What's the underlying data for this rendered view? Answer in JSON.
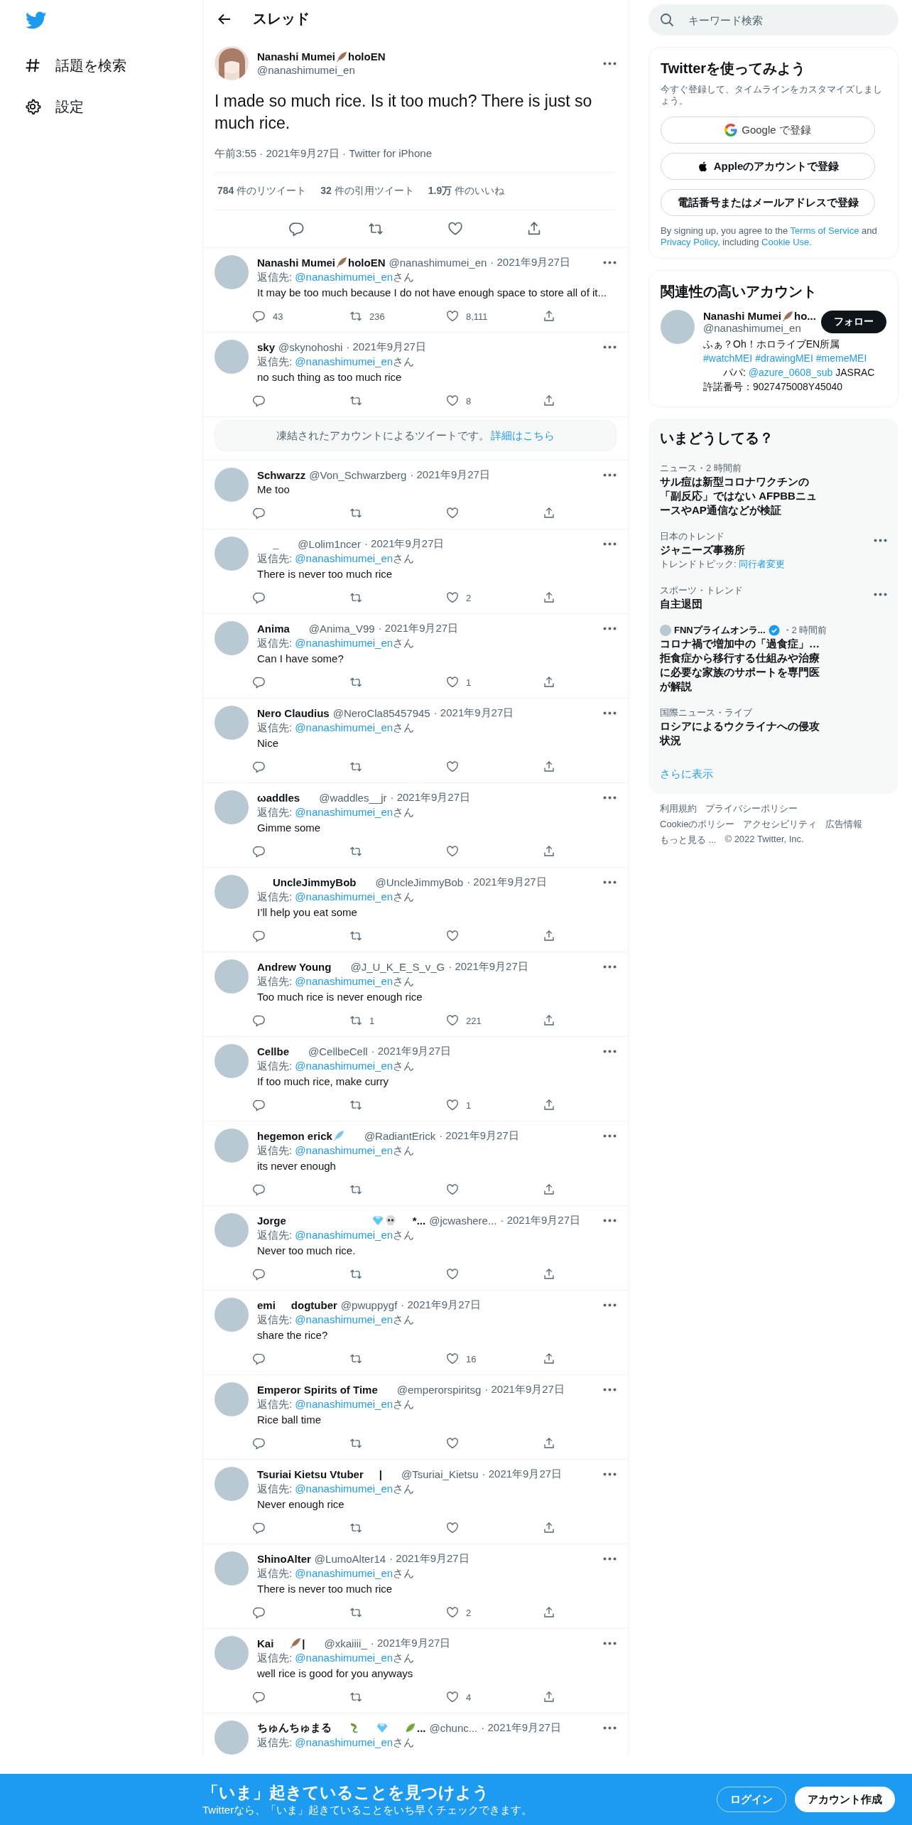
{
  "sidebar": {
    "items": [
      {
        "kind": "explore",
        "label": "話題を検索"
      },
      {
        "kind": "settings",
        "label": "設定"
      }
    ]
  },
  "header": {
    "title": "スレッド"
  },
  "tweet": {
    "name": [
      {
        "kind": "text",
        "text": "Nanashi Mumei"
      },
      {
        "kind": "feather"
      },
      {
        "kind": "text",
        "text": "holoEN"
      }
    ],
    "handle": "@nanashimumei_en",
    "text": "I made so much rice. Is it too much? There is just so much rice.",
    "meta": "午前3:55 · 2021年9月27日 · Twitter for iPhone",
    "stats": [
      "**784** 件のリツイート",
      "**32** 件の引用ツイート",
      "**1.9万** 件のいいね"
    ]
  },
  "replies": [
    {
      "kind": "tweet",
      "name": [
        {
          "kind": "text",
          "text": "Nanashi Mumei"
        },
        {
          "kind": "feather"
        },
        {
          "kind": "text",
          "text": "holoEN"
        }
      ],
      "handle": "@nanashimumei_en",
      "date": "· 2021年9月27日",
      "reply_to": {
        "prefix": "返信先: ",
        "handle": "@nanashimumei_en",
        "suffix": "さん"
      },
      "text": "It may be too much because I do not have enough space to store all of it...",
      "counts": {
        "reply": "43",
        "retweet": "236",
        "like": "8,111"
      }
    },
    {
      "kind": "tweet",
      "name": [
        {
          "kind": "text",
          "text": "sky"
        }
      ],
      "handle": "@skynohoshi",
      "date": "· 2021年9月27日",
      "reply_to": {
        "prefix": "返信先: ",
        "handle": "@nanashimumei_en",
        "suffix": "さん"
      },
      "text": "no such thing as too much rice",
      "counts": {
        "like": "8"
      }
    },
    {
      "kind": "notice",
      "text": "凍結されたアカウントによるツイートです。",
      "link": "詳細はこちら"
    },
    {
      "kind": "tweet",
      "name": [
        {
          "kind": "text",
          "text": "Schwarzz"
        }
      ],
      "handle": "@Von_Schwarzberg",
      "date": "· 2021年9月27日",
      "text": "Me too"
    },
    {
      "kind": "tweet",
      "name": [
        {
          "kind": "gap"
        },
        {
          "kind": "text",
          "text": "_"
        },
        {
          "kind": "gap"
        }
      ],
      "handle": "@Lolim1ncer",
      "date": "· 2021年9月27日",
      "reply_to": {
        "prefix": "返信先: ",
        "handle": "@nanashimumei_en",
        "suffix": "さん"
      },
      "text": "There is never too much rice",
      "counts": {
        "like": "2"
      }
    },
    {
      "kind": "tweet",
      "name": [
        {
          "kind": "text",
          "text": "Anima"
        },
        {
          "kind": "gap"
        }
      ],
      "handle": "@Anima_V99",
      "date": "· 2021年9月27日",
      "reply_to": {
        "prefix": "返信先: ",
        "handle": "@nanashimumei_en",
        "suffix": "さん"
      },
      "text": "Can I have some?",
      "counts": {
        "like": "1"
      }
    },
    {
      "kind": "tweet",
      "name": [
        {
          "kind": "text",
          "text": "Nero Claudius"
        }
      ],
      "handle": "@NeroCla85457945",
      "date": "· 2021年9月27日",
      "reply_to": {
        "prefix": "返信先: ",
        "handle": "@nanashimumei_en",
        "suffix": "さん"
      },
      "text": "Nice"
    },
    {
      "kind": "tweet",
      "name": [
        {
          "kind": "text",
          "text": "ωaddles"
        },
        {
          "kind": "gap"
        }
      ],
      "handle": "@waddles__jr",
      "date": "· 2021年9月27日",
      "reply_to": {
        "prefix": "返信先: ",
        "handle": "@nanashimumei_en",
        "suffix": "さん"
      },
      "text": "Gimme some"
    },
    {
      "kind": "tweet",
      "name": [
        {
          "kind": "gap"
        },
        {
          "kind": "text",
          "text": "UncleJimmyBob"
        },
        {
          "kind": "gap"
        }
      ],
      "handle": "@UncleJimmyBob",
      "date": "· 2021年9月27日",
      "reply_to": {
        "prefix": "返信先: ",
        "handle": "@nanashimumei_en",
        "suffix": "さん"
      },
      "text": "I’ll help you eat some"
    },
    {
      "kind": "tweet",
      "name": [
        {
          "kind": "text",
          "text": "Andrew Young"
        },
        {
          "kind": "gap"
        }
      ],
      "handle": "@J_U_K_E_S_v_G",
      "date": "· 2021年9月27日",
      "reply_to": {
        "prefix": "返信先: ",
        "handle": "@nanashimumei_en",
        "suffix": "さん"
      },
      "text": "Too much rice is never enough rice",
      "counts": {
        "retweet": "1",
        "like": "221"
      }
    },
    {
      "kind": "tweet",
      "name": [
        {
          "kind": "text",
          "text": "Cellbe"
        },
        {
          "kind": "gap"
        }
      ],
      "handle": "@CellbeCell",
      "date": "· 2021年9月27日",
      "reply_to": {
        "prefix": "返信先: ",
        "handle": "@nanashimumei_en",
        "suffix": "さん"
      },
      "text": "If too much rice, make curry",
      "counts": {
        "like": "1"
      }
    },
    {
      "kind": "tweet",
      "name": [
        {
          "kind": "text",
          "text": "hegemon erick"
        },
        {
          "kind": "blue-feather"
        },
        {
          "kind": "gap"
        }
      ],
      "handle": "@RadiantErick",
      "date": "· 2021年9月27日",
      "reply_to": {
        "prefix": "返信先: ",
        "handle": "@nanashimumei_en",
        "suffix": "さん"
      },
      "text": "its never enough"
    },
    {
      "kind": "tweet",
      "name": [
        {
          "kind": "text",
          "text": "Jorge"
        },
        {
          "kind": "wide-gap"
        },
        {
          "kind": "gem"
        },
        {
          "kind": "skull"
        },
        {
          "kind": "gap"
        },
        {
          "kind": "text",
          "text": "*..."
        }
      ],
      "handle": "@jcwashere...",
      "date": "· 2021年9月27日",
      "reply_to": {
        "prefix": "返信先: ",
        "handle": "@nanashimumei_en",
        "suffix": "さん"
      },
      "text": "Never too much rice."
    },
    {
      "kind": "tweet",
      "name": [
        {
          "kind": "text",
          "text": "emi"
        },
        {
          "kind": "gap"
        },
        {
          "kind": "text",
          "text": "dogtuber"
        }
      ],
      "handle": "@pwuppygf",
      "date": "· 2021年9月27日",
      "reply_to": {
        "prefix": "返信先: ",
        "handle": "@nanashimumei_en",
        "suffix": "さん"
      },
      "text": "share the rice?",
      "counts": {
        "like": "16"
      }
    },
    {
      "kind": "tweet",
      "name": [
        {
          "kind": "text",
          "text": "Emperor Spirits of Time"
        },
        {
          "kind": "gap"
        }
      ],
      "handle": "@emperorspiritsg",
      "date": "· 2021年9月27日",
      "reply_to": {
        "prefix": "返信先: ",
        "handle": "@nanashimumei_en",
        "suffix": "さん"
      },
      "text": "Rice ball time"
    },
    {
      "kind": "tweet",
      "name": [
        {
          "kind": "text",
          "text": "Tsuriai Kietsu Vtuber"
        },
        {
          "kind": "gap"
        },
        {
          "kind": "text",
          "text": "|"
        },
        {
          "kind": "gap"
        }
      ],
      "handle": "@Tsuriai_Kietsu",
      "date": "· 2021年9月27日",
      "reply_to": {
        "prefix": "返信先: ",
        "handle": "@nanashimumei_en",
        "suffix": "さん"
      },
      "text": "Never enough rice"
    },
    {
      "kind": "tweet",
      "name": [
        {
          "kind": "text",
          "text": "ShinoAlter"
        }
      ],
      "handle": "@LumoAlter14",
      "date": "· 2021年9月27日",
      "reply_to": {
        "prefix": "返信先: ",
        "handle": "@nanashimumei_en",
        "suffix": "さん"
      },
      "text": "There is never too much rice",
      "counts": {
        "like": "2"
      }
    },
    {
      "kind": "tweet",
      "name": [
        {
          "kind": "text",
          "text": "Kai"
        },
        {
          "kind": "gap"
        },
        {
          "kind": "feather"
        },
        {
          "kind": "text",
          "text": "|"
        },
        {
          "kind": "gap"
        }
      ],
      "handle": "@xkaiiii_",
      "date": "· 2021年9月27日",
      "reply_to": {
        "prefix": "返信先: ",
        "handle": "@nanashimumei_en",
        "suffix": "さん"
      },
      "text": "well rice is good for you anyways",
      "counts": {
        "like": "4"
      }
    },
    {
      "kind": "tweet",
      "name": [
        {
          "kind": "text",
          "text": "ちゅんちゅまる"
        },
        {
          "kind": "gap"
        },
        {
          "kind": "dragon"
        },
        {
          "kind": "gap"
        },
        {
          "kind": "gem"
        },
        {
          "kind": "gap"
        },
        {
          "kind": "leaf"
        },
        {
          "kind": "text",
          "text": "..."
        }
      ],
      "handle": "@chunc...",
      "date": "· 2021年9月27日",
      "reply_to": {
        "prefix": "返信先: ",
        "handle": "@nanashimumei_en",
        "suffix": "さん"
      }
    }
  ],
  "search": {
    "placeholder": "キーワード検索"
  },
  "signup": {
    "title": "Twitterを使ってみよう",
    "subtitle": "今すぐ登録して、タイムラインをカスタマイズしましょう。",
    "buttons": [
      {
        "kind": "google",
        "label": "Google で登録"
      },
      {
        "kind": "apple",
        "label": "Appleのアカウントで登録"
      },
      {
        "kind": "plain",
        "label": "電話番号またはメールアドレスで登録"
      }
    ],
    "legal": [
      {
        "kind": "text",
        "text": "By signing up, you agree to the "
      },
      {
        "kind": "link",
        "text": "Terms of Service"
      },
      {
        "kind": "text",
        "text": " and "
      },
      {
        "kind": "link",
        "text": "Privacy Policy"
      },
      {
        "kind": "text",
        "text": ", including "
      },
      {
        "kind": "link",
        "text": "Cookie Use."
      }
    ]
  },
  "related": {
    "title": "関連性の高いアカウント",
    "accounts": [
      {
        "name": [
          {
            "kind": "text",
            "text": "Nanashi Mumei"
          },
          {
            "kind": "feather"
          },
          {
            "kind": "text",
            "text": "ho..."
          }
        ],
        "handle": "@nanashimumei_en",
        "button": "フォロー",
        "bio": [
          {
            "kind": "text",
            "text": "ふぁ？Oh！ホロライブEN所属"
          },
          {
            "kind": "break"
          },
          {
            "kind": "link",
            "text": "#watchMEI"
          },
          {
            "kind": "space"
          },
          {
            "kind": "link",
            "text": "#drawingMEI"
          },
          {
            "kind": "space"
          },
          {
            "kind": "link",
            "text": "#memeMEI"
          },
          {
            "kind": "break"
          },
          {
            "kind": "text",
            "text": "　　パパ: "
          },
          {
            "kind": "link",
            "text": "@azure_0608_sub"
          },
          {
            "kind": "text",
            "text": " JASRAC"
          },
          {
            "kind": "break"
          },
          {
            "kind": "text",
            "text": "許諾番号：9027475008Y45040"
          }
        ]
      }
    ]
  },
  "trends": {
    "title": "いまどうしてる？",
    "items": [
      {
        "kind": "news",
        "context": "ニュース・2 時間前",
        "title": "サル痘は新型コロナワクチンの「副反応」ではない AFPBBニュースやAP通信などが検証"
      },
      {
        "kind": "trend",
        "context": "日本のトレンド",
        "title": "ジャニーズ事務所",
        "topic_label": "トレンドトピック: ",
        "topic": "同行者変更",
        "more": true
      },
      {
        "kind": "trend",
        "context": "スポーツ・トレンド",
        "title": "自主退団",
        "more": true
      },
      {
        "kind": "source",
        "source": "FNNプライムオンラ...",
        "verified": true,
        "time": "・2 時間前",
        "title": "コロナ禍で増加中の「過食症」…拒食症から移行する仕組みや治療に必要な家族のサポートを専門医が解説"
      },
      {
        "kind": "news",
        "context": "国際ニュース・ライブ",
        "title": "ロシアによるウクライナへの侵攻状況"
      }
    ],
    "show_more": "さらに表示"
  },
  "footer": {
    "links": [
      "利用規約",
      "プライバシーポリシー",
      "Cookieのポリシー",
      "アクセシビリティ",
      "広告情報",
      "もっと見る ..."
    ],
    "copyright": "© 2022 Twitter, Inc."
  },
  "banner": {
    "title": "「いま」起きていることを見つけよう",
    "subtitle": "Twitterなら、「いま」起きていることをいち早くチェックできます。",
    "buttons": [
      {
        "kind": "outline",
        "label": "ログイン"
      },
      {
        "kind": "filled",
        "label": "アカウント作成"
      }
    ]
  }
}
